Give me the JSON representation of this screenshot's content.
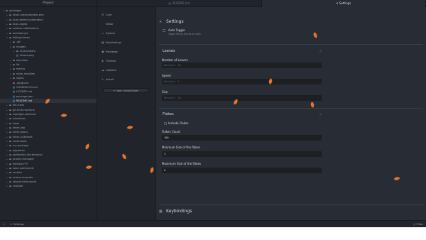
{
  "tree": {
    "header": "Project",
    "rows": [
      {
        "label": "packages",
        "depth": 0,
        "type": "folder",
        "open": true
      },
      {
        "label": "atom-autocomplete-php",
        "depth": 1,
        "type": "folder"
      },
      {
        "label": "auto-detect-indentation",
        "depth": 1,
        "type": "folder"
      },
      {
        "label": "busy-signal",
        "depth": 1,
        "type": "folder"
      },
      {
        "label": "custom-notifications",
        "depth": 1,
        "type": "folder"
      },
      {
        "label": "docblokr-jsx",
        "depth": 1,
        "type": "folder"
      },
      {
        "label": "falling-leaves",
        "depth": 1,
        "type": "folder",
        "open": true
      },
      {
        "label": ".git",
        "depth": 2,
        "type": "folder"
      },
      {
        "label": "images",
        "depth": 2,
        "type": "folder",
        "open": true
      },
      {
        "label": "screenshots",
        "depth": 3,
        "type": "folder"
      },
      {
        "label": "leaves.png",
        "depth": 3,
        "type": "file"
      },
      {
        "label": "keymaps",
        "depth": 2,
        "type": "folder"
      },
      {
        "label": "lib",
        "depth": 2,
        "type": "folder"
      },
      {
        "label": "menus",
        "depth": 2,
        "type": "folder"
      },
      {
        "label": "node_modules",
        "depth": 2,
        "type": "folder"
      },
      {
        "label": "styles",
        "depth": 2,
        "type": "folder"
      },
      {
        "label": ".gitignore",
        "depth": 2,
        "type": "file-red"
      },
      {
        "label": "CHANGELOG.md",
        "depth": 2,
        "type": "file"
      },
      {
        "label": "LICENSE.md",
        "depth": 2,
        "type": "file"
      },
      {
        "label": "package.json",
        "depth": 2,
        "type": "file"
      },
      {
        "label": "README.md",
        "depth": 2,
        "type": "file",
        "selected": true
      },
      {
        "label": "file-icons",
        "depth": 1,
        "type": "folder"
      },
      {
        "label": "git-time-machine",
        "depth": 1,
        "type": "folder"
      },
      {
        "label": "highlight-selected",
        "depth": 1,
        "type": "folder"
      },
      {
        "label": "intentions",
        "depth": 1,
        "type": "folder"
      },
      {
        "label": "linter",
        "depth": 1,
        "type": "folder"
      },
      {
        "label": "linter-php",
        "depth": 1,
        "type": "folder"
      },
      {
        "label": "linter-phpcs",
        "depth": 1,
        "type": "folder"
      },
      {
        "label": "linter-ui-default",
        "depth": 1,
        "type": "folder"
      },
      {
        "label": "node-flows",
        "depth": 1,
        "type": "folder"
      },
      {
        "label": "my-package",
        "depth": 1,
        "type": "folder"
      },
      {
        "label": "pigments",
        "depth": 1,
        "type": "folder"
      },
      {
        "label": "platformio-ide-terminal",
        "depth": 1,
        "type": "folder"
      },
      {
        "label": "project-manager",
        "depth": 1,
        "type": "folder"
      },
      {
        "label": "Remote-FTP",
        "depth": 1,
        "type": "folder"
      },
      {
        "label": "save-commands",
        "depth": 1,
        "type": "folder"
      },
      {
        "label": "scratch",
        "depth": 1,
        "type": "folder"
      },
      {
        "label": "screen-recorder",
        "depth": 1,
        "type": "folder"
      },
      {
        "label": "simple-hello-world",
        "depth": 1,
        "type": "folder"
      },
      {
        "label": "sniptool",
        "depth": 1,
        "type": "folder"
      }
    ]
  },
  "tabs": [
    {
      "label": "README.md",
      "icon": "book-icon",
      "active": false
    },
    {
      "label": "Settings",
      "icon": "tools-icon",
      "active": true
    }
  ],
  "nav": {
    "items": [
      {
        "label": "Core",
        "icon": "settings-icon"
      },
      {
        "label": "Editor",
        "icon": "code-icon"
      },
      {
        "label": "System",
        "icon": "device-desktop-icon"
      },
      {
        "label": "Keybindings",
        "icon": "keyboard-icon"
      },
      {
        "label": "Packages",
        "icon": "package-icon"
      },
      {
        "label": "Themes",
        "icon": "paintcan-icon"
      },
      {
        "label": "Updates",
        "icon": "cloud-download-icon"
      },
      {
        "label": "Install",
        "icon": "plus-icon"
      }
    ],
    "config_button": "Open Config Folder"
  },
  "settings": {
    "title": "Settings",
    "auto_toggle_label": "Auto Toggle",
    "auto_toggle_desc": "Toggle falling leaves on start",
    "leaves": {
      "title": "Leaves",
      "number_label": "Number of Leaves",
      "number_placeholder": "Default: 10",
      "speed_label": "Speed",
      "speed_placeholder": "Default: 1",
      "size_label": "Size",
      "size_placeholder": "Default: 30"
    },
    "flakes": {
      "title": "Flakes",
      "include_label": "Include Flakes",
      "count_label": "Flakes Count",
      "count_value": "100",
      "min_label": "Minimum Size of the flakes",
      "min_value": "3",
      "max_label": "Maximum Size of the flakes",
      "max_value": "6"
    },
    "keybindings_title": "Keybindings"
  },
  "status": {
    "add": "+",
    "tab_icon": "tools-icon",
    "tab_label": "Settings",
    "files_label": "0 files",
    "files_icon": "file-icon"
  },
  "colors": {
    "leaf": "#e8742a",
    "background": "#282c34",
    "panel": "#21252b"
  }
}
